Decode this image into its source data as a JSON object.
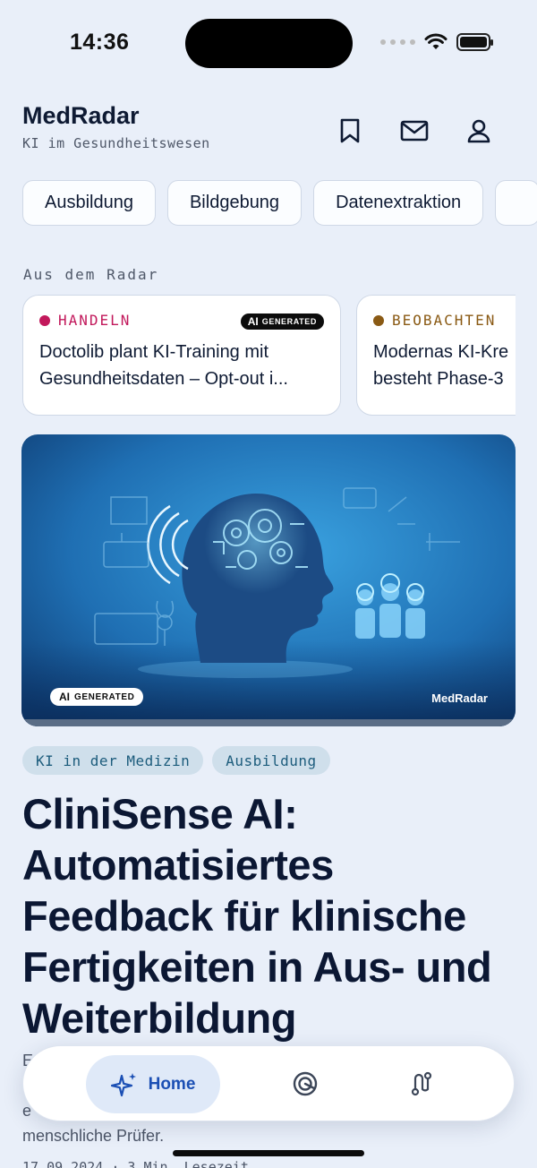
{
  "status": {
    "time": "14:36",
    "battery_level": 1.0
  },
  "header": {
    "title": "MedRadar",
    "subtitle": "KI im Gesundheitswesen",
    "icons": [
      "bookmark-icon",
      "mail-icon",
      "profile-icon"
    ]
  },
  "categories": [
    "Ausbildung",
    "Bildgebung",
    "Datenextraktion",
    ""
  ],
  "radar": {
    "label": "Aus dem Radar",
    "cards": [
      {
        "tag": "HANDELN",
        "tag_color": "#c2185b",
        "badge": "GENERATED",
        "badge_ai": "AI",
        "title": "Doctolib plant KI-Training mit Gesundheitsdaten – Opt-out i..."
      },
      {
        "tag": "BEOBACHTEN",
        "tag_color": "#8a5a14",
        "title": "Modernas KI-Kre besteht Phase-3"
      }
    ]
  },
  "hero": {
    "badge_ai": "AI",
    "badge": "GENERATED",
    "brand": "MedRadar"
  },
  "article": {
    "tags": [
      "KI in der Medizin",
      "Ausbildung"
    ],
    "title": "CliniSense AI: Automatisiertes Feedback für klinische Fertigkeiten in Aus- und Weiterbildung",
    "teaser_lines": [
      "E",
      "",
      "e",
      "menschliche Prüfer."
    ],
    "meta": "17.09.2024 · 3 Min. Lesezeit"
  },
  "nav": {
    "home_label": "Home",
    "items": [
      "sparkle-icon",
      "radar-icon",
      "route-icon"
    ]
  },
  "colors": {
    "accent": "#1b4fb4",
    "background": "#e9eff9",
    "text": "#0e1a33"
  }
}
